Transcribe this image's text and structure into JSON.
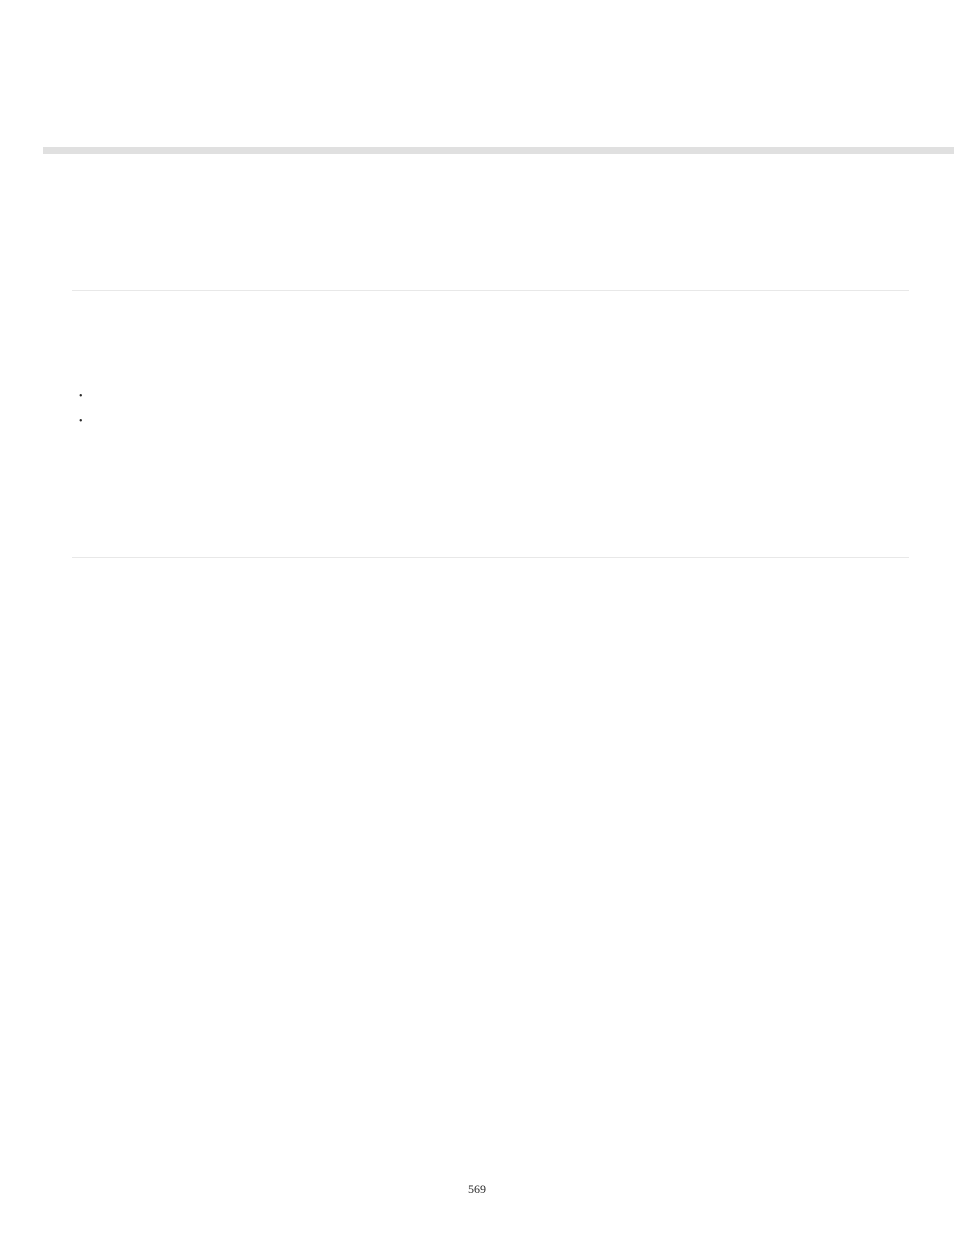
{
  "page": {
    "number": "569"
  },
  "list": {
    "items": [
      "",
      ""
    ]
  }
}
